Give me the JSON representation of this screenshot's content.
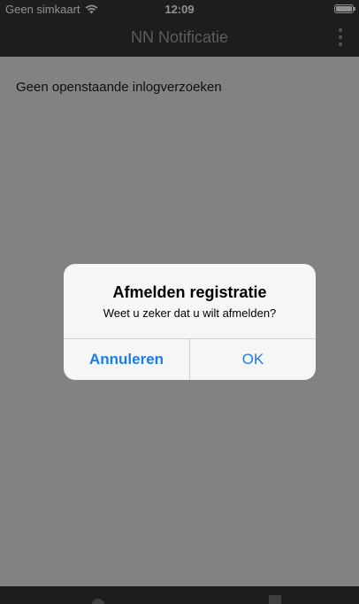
{
  "status_bar": {
    "carrier": "Geen simkaart",
    "time": "12:09",
    "wifi_icon": "wifi-icon",
    "battery_icon": "battery-icon"
  },
  "app_bar": {
    "title": "NN Notificatie",
    "menu_icon": "more-vertical-icon"
  },
  "content": {
    "empty_message": "Geen openstaande inlogverzoeken"
  },
  "dialog": {
    "title": "Afmelden registratie",
    "message": "Weet u zeker dat u wilt afmelden?",
    "cancel_label": "Annuleren",
    "ok_label": "OK"
  },
  "colors": {
    "accent": "#1a7cf0",
    "app_bar": "#313131",
    "background": "#d9d9d9"
  }
}
